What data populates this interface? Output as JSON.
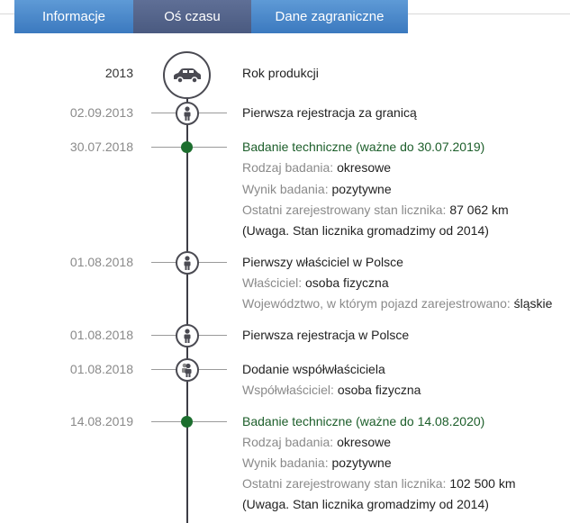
{
  "tabs": [
    "Informacje",
    "Oś czasu",
    "Dane zagraniczne"
  ],
  "events": [
    {
      "date": "2013",
      "title": "Rok produkcji",
      "icon": "car-icon"
    },
    {
      "date": "02.09.2013",
      "title": "Pierwsza rejestracja za granicą",
      "icon": "person-icon"
    },
    {
      "date": "30.07.2018",
      "title": "Badanie techniczne (ważne do 30.07.2019)",
      "rows": [
        [
          "Rodzaj badania: ",
          "okresowe"
        ],
        [
          "Wynik badania: ",
          "pozytywne"
        ],
        [
          "Ostatni zarejestrowany stan licznika: ",
          "87 062 km"
        ]
      ],
      "note": "(Uwaga. Stan licznika gromadzimy od 2014)"
    },
    {
      "date": "01.08.2018",
      "title": "Pierwszy właściciel w Polsce",
      "icon": "person-icon",
      "rows": [
        [
          "Właściciel: ",
          "osoba fizyczna"
        ],
        [
          "Województwo, w którym pojazd zarejestrowano: ",
          "śląskie"
        ]
      ]
    },
    {
      "date": "01.08.2018",
      "title": "Pierwsza rejestracja w Polsce",
      "icon": "person-icon"
    },
    {
      "date": "01.08.2018",
      "title": "Dodanie współwłaściciela",
      "icon": "co-owner-icon",
      "rows": [
        [
          "Współwłaściciel: ",
          "osoba fizyczna"
        ]
      ]
    },
    {
      "date": "14.08.2019",
      "title": "Badanie techniczne (ważne do 14.08.2020)",
      "rows": [
        [
          "Rodzaj badania: ",
          "okresowe"
        ],
        [
          "Wynik badania: ",
          "pozytywne"
        ],
        [
          "Ostatni zarejestrowany stan licznika: ",
          "102 500 km"
        ]
      ],
      "note": "(Uwaga. Stan licznika gromadzimy od 2014)"
    }
  ]
}
